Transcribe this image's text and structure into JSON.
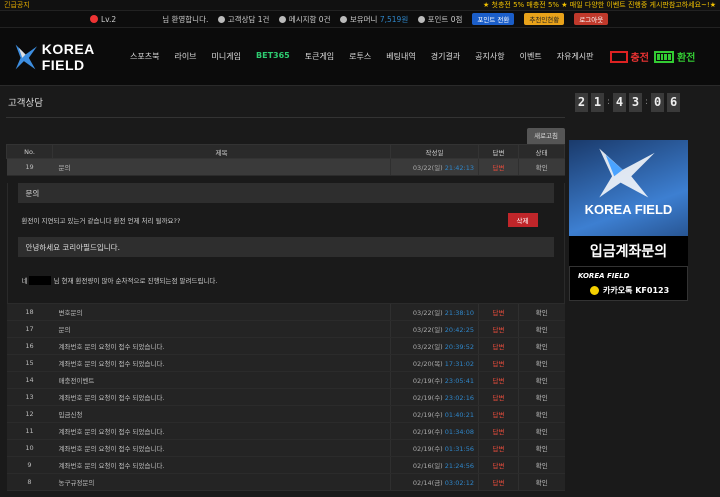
{
  "topbar": {
    "notice_label": "긴급공지",
    "ticker": "★ 첫충전 5% 매충전 5% ★ 매일 다양한 이벤트 진행중 게시판참고하세요~!★"
  },
  "userbar": {
    "level": "Lv.2",
    "greeting": "님 환영합니다.",
    "inquiry": "고객상담 1건",
    "message": "메시지함 0건",
    "money_label": "보유머니",
    "money_value": "7,519원",
    "point_label": "포인트 0점",
    "point_convert": "포인트 전환",
    "recommend": "추천인현황",
    "logout": "로그아웃"
  },
  "nav": {
    "logo_text": "KOREA FIELD",
    "menu": [
      "스포츠북",
      "라이브",
      "미니게임",
      "BET365",
      "토큰게임",
      "로투스",
      "베팅내역",
      "경기결과",
      "공지사항",
      "이벤트",
      "자유게시판"
    ],
    "charge": "충전",
    "exchange": "환전"
  },
  "page": {
    "title": "고객상담",
    "refresh": "새로고침"
  },
  "table": {
    "headers": [
      "No.",
      "제목",
      "작성일",
      "답변",
      "상태"
    ],
    "active_row": {
      "no": "19",
      "title": "문의",
      "date": "03/22(일)",
      "time": "21:42:13",
      "answer": "답변",
      "status": "확인"
    },
    "rows": [
      {
        "no": "18",
        "title": "변호문의",
        "date": "03/22(일)",
        "time": "21:38:10",
        "answer": "답변",
        "status": "확인"
      },
      {
        "no": "17",
        "title": "문의",
        "date": "03/22(일)",
        "time": "20:42:25",
        "answer": "답변",
        "status": "확인"
      },
      {
        "no": "16",
        "title": "계좌번호 문의 요청이 접수 되었습니다.",
        "date": "03/22(일)",
        "time": "20:39:52",
        "answer": "답변",
        "status": "확인"
      },
      {
        "no": "15",
        "title": "계좌번호 문의 요청이 접수 되었습니다.",
        "date": "02/20(목)",
        "time": "17:31:02",
        "answer": "답변",
        "status": "확인"
      },
      {
        "no": "14",
        "title": "매충전이벤트",
        "date": "02/19(수)",
        "time": "23:05:41",
        "answer": "답변",
        "status": "확인"
      },
      {
        "no": "13",
        "title": "계좌번호 문의 요청이 접수 되었습니다.",
        "date": "02/19(수)",
        "time": "23:02:16",
        "answer": "답변",
        "status": "확인"
      },
      {
        "no": "12",
        "title": "입금신청",
        "date": "02/19(수)",
        "time": "01:40:21",
        "answer": "답변",
        "status": "확인"
      },
      {
        "no": "11",
        "title": "계좌번호 문의 요청이 접수 되었습니다.",
        "date": "02/19(수)",
        "time": "01:34:08",
        "answer": "답변",
        "status": "확인"
      },
      {
        "no": "10",
        "title": "계좌번호 문의 요청이 접수 되었습니다.",
        "date": "02/19(수)",
        "time": "01:31:56",
        "answer": "답변",
        "status": "확인"
      },
      {
        "no": "9",
        "title": "계좌번호 문의 요청이 접수 되었습니다.",
        "date": "02/16(일)",
        "time": "21:24:56",
        "answer": "답변",
        "status": "확인"
      },
      {
        "no": "8",
        "title": "농구규정문의",
        "date": "02/14(금)",
        "time": "03:02:12",
        "answer": "답변",
        "status": "확인"
      }
    ]
  },
  "detail": {
    "question_head": "문의",
    "question_body": "환전이 지연되고 있는거 같습니다 환전 언제 처리 될까요??",
    "delete": "삭제",
    "reply_head": "안녕하세요 코리아필드입니다.",
    "reply_prefix": "네",
    "reply_body": "님 현재 환전량이 많아 순차적으로 진행되는점 말려드립니다."
  },
  "sidebar": {
    "clock": [
      "2",
      "1",
      "4",
      "3",
      "0",
      "6"
    ],
    "banner1_logo": "KOREA FIELD",
    "banner1_text": "입금계좌문의",
    "banner2_logo": "KOREA FIELD",
    "banner2_kakao": "카카오톡  KF0123"
  }
}
